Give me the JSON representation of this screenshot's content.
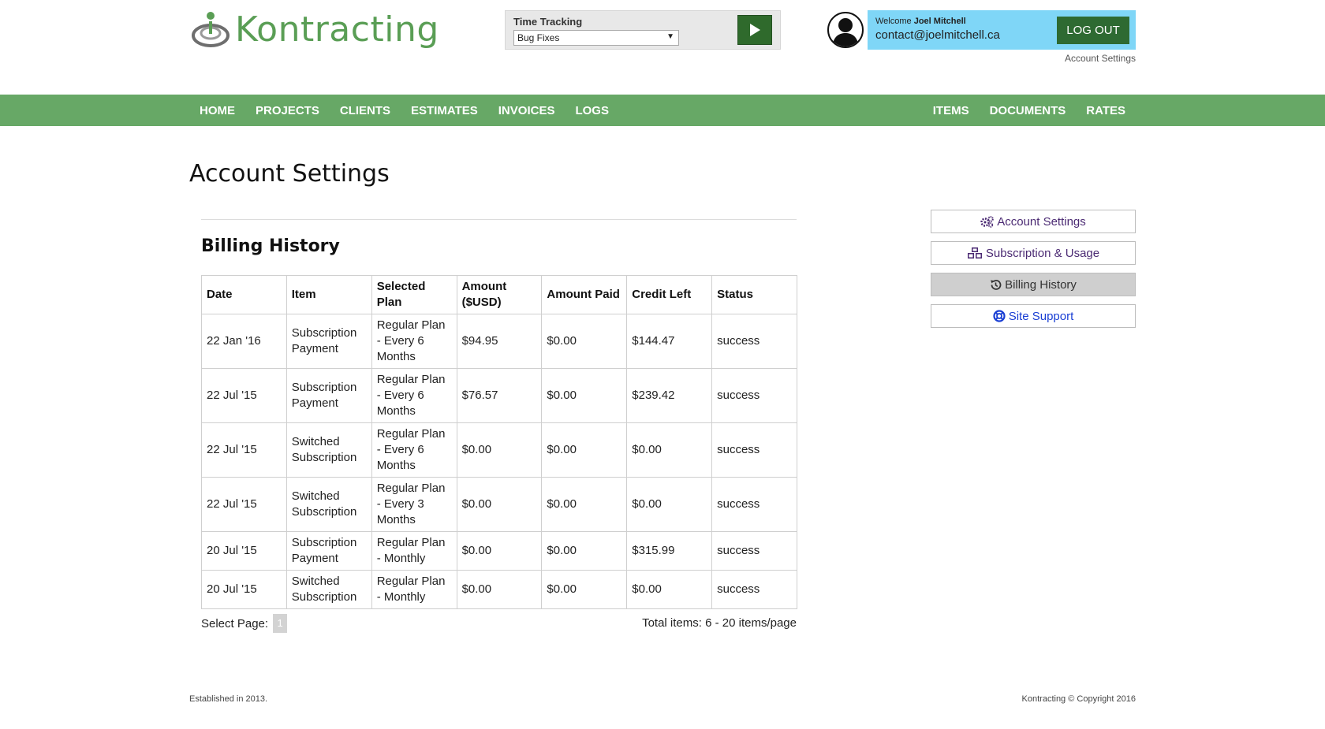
{
  "brand": {
    "name": "Kontracting"
  },
  "time_tracking": {
    "label": "Time Tracking",
    "selected": "Bug Fixes"
  },
  "user": {
    "welcome_prefix": "Welcome",
    "name": "Joel Mitchell",
    "email": "contact@joelmitchell.ca",
    "logout_label": "LOG OUT",
    "account_link": "Account Settings"
  },
  "nav": {
    "left": [
      "HOME",
      "PROJECTS",
      "CLIENTS",
      "ESTIMATES",
      "INVOICES",
      "LOGS"
    ],
    "right": [
      "ITEMS",
      "DOCUMENTS",
      "RATES"
    ]
  },
  "page": {
    "title": "Account Settings",
    "section_title": "Billing History"
  },
  "billing": {
    "columns": [
      "Date",
      "Item",
      "Selected Plan",
      "Amount ($USD)",
      "Amount Paid",
      "Credit Left",
      "Status"
    ],
    "rows": [
      [
        "22 Jan '16",
        "Subscription Payment",
        "Regular Plan - Every 6 Months",
        "$94.95",
        "$0.00",
        "$144.47",
        "success"
      ],
      [
        "22 Jul '15",
        "Subscription Payment",
        "Regular Plan - Every 6 Months",
        "$76.57",
        "$0.00",
        "$239.42",
        "success"
      ],
      [
        "22 Jul '15",
        "Switched Subscription",
        "Regular Plan - Every 6 Months",
        "$0.00",
        "$0.00",
        "$0.00",
        "success"
      ],
      [
        "22 Jul '15",
        "Switched Subscription",
        "Regular Plan - Every 3 Months",
        "$0.00",
        "$0.00",
        "$0.00",
        "success"
      ],
      [
        "20 Jul '15",
        "Subscription Payment",
        "Regular Plan - Monthly",
        "$0.00",
        "$0.00",
        "$315.99",
        "success"
      ],
      [
        "20 Jul '15",
        "Switched Subscription",
        "Regular Plan - Monthly",
        "$0.00",
        "$0.00",
        "$0.00",
        "success"
      ]
    ]
  },
  "pagination": {
    "label": "Select Page:",
    "current": "1",
    "total_text": "Total items: 6 - 20 items/page"
  },
  "side_menu": {
    "account_settings": "Account Settings",
    "subscription_usage": "Subscription & Usage",
    "billing_history": "Billing History",
    "site_support": "Site Support"
  },
  "footer": {
    "left": "Established in 2013.",
    "right": "Kontracting © Copyright 2016"
  },
  "colors": {
    "nav_green": "#67a866",
    "brand_green": "#5a9e55",
    "dark_green": "#2e6a32",
    "user_box_blue": "#7fd6f7",
    "side_link_purple": "#4b2a73",
    "support_blue": "#1a3fd4"
  },
  "icons": [
    "logo-icon",
    "play-icon",
    "avatar-icon",
    "cogs-icon",
    "cubes-icon",
    "history-icon",
    "life-ring-icon",
    "chevron-down-icon"
  ]
}
